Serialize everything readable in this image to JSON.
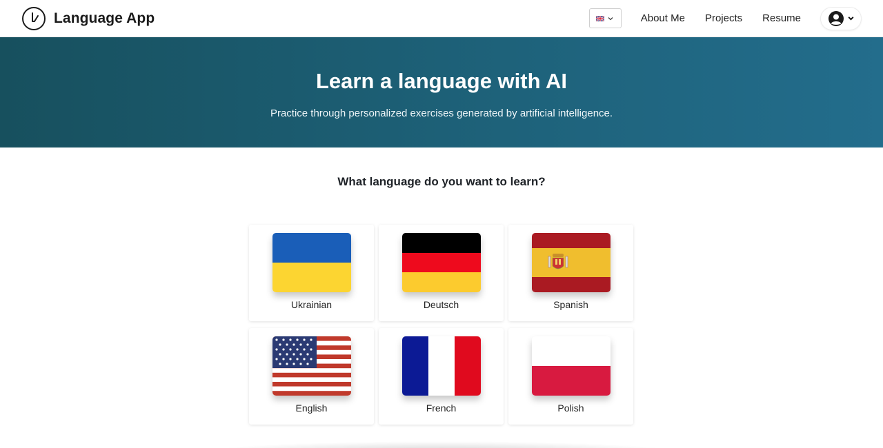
{
  "header": {
    "title": "Language App",
    "nav": {
      "about": "About Me",
      "projects": "Projects",
      "resume": "Resume"
    },
    "language_selector_icon": "uk-flag-icon",
    "user_icon": "user-avatar-icon"
  },
  "hero": {
    "title": "Learn a language with AI",
    "subtitle": "Practice through personalized exercises generated by artificial intelligence.",
    "gradient_start": "#17505e",
    "gradient_end": "#236d8c"
  },
  "main": {
    "question": "What language do you want to learn?",
    "languages": [
      {
        "label": "Ukrainian",
        "flag": "ukraine-flag"
      },
      {
        "label": "Deutsch",
        "flag": "germany-flag"
      },
      {
        "label": "Spanish",
        "flag": "spain-flag"
      },
      {
        "label": "English",
        "flag": "usa-flag"
      },
      {
        "label": "French",
        "flag": "france-flag"
      },
      {
        "label": "Polish",
        "flag": "poland-flag"
      }
    ]
  }
}
